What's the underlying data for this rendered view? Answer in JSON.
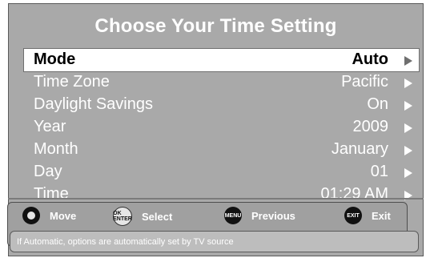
{
  "title": "Choose Your Time Setting",
  "rows": [
    {
      "label": "Mode",
      "value": "Auto",
      "selected": true
    },
    {
      "label": "Time Zone",
      "value": "Pacific",
      "selected": false
    },
    {
      "label": "Daylight Savings",
      "value": "On",
      "selected": false
    },
    {
      "label": "Year",
      "value": "2009",
      "selected": false
    },
    {
      "label": "Month",
      "value": "January",
      "selected": false
    },
    {
      "label": "Day",
      "value": "01",
      "selected": false
    },
    {
      "label": "Time",
      "value": "01:29 AM",
      "selected": false
    }
  ],
  "hints": [
    {
      "icon": "dpad-icon",
      "label": "Move"
    },
    {
      "icon": "ok-enter-icon",
      "icon_text": "OK ENTER",
      "label": "Select"
    },
    {
      "icon": "menu-icon",
      "icon_text": "MENU",
      "label": "Previous"
    },
    {
      "icon": "exit-icon",
      "icon_text": "EXIT",
      "label": "Exit"
    }
  ],
  "info_text": "If Automatic, options are automatically set by TV source",
  "colors": {
    "panel": "#a9a9a9",
    "selected_row": "#ffffff",
    "text": "#ffffff",
    "selected_text": "#000000"
  }
}
